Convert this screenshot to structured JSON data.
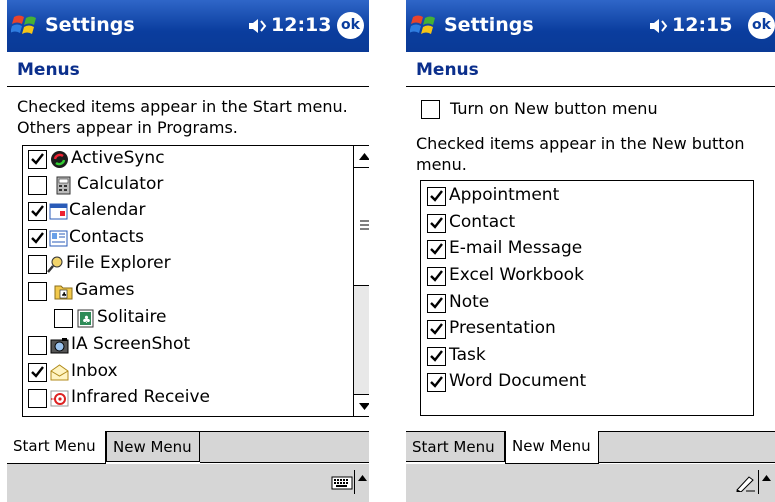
{
  "left": {
    "title": "Settings",
    "time": "12:13",
    "ok_label": "ok",
    "heading": "Menus",
    "description_line1": "Checked items appear in the Start menu.",
    "description_line2": "Others appear in Programs.",
    "items": [
      {
        "label": "ActiveSync",
        "checked": true,
        "icon": "activesync-icon"
      },
      {
        "label": "Calculator",
        "checked": false,
        "icon": "calculator-icon"
      },
      {
        "label": "Calendar",
        "checked": true,
        "icon": "calendar-icon"
      },
      {
        "label": "Contacts",
        "checked": true,
        "icon": "contacts-icon"
      },
      {
        "label": "File Explorer",
        "checked": false,
        "icon": "file-explorer-icon"
      },
      {
        "label": "Games",
        "checked": false,
        "icon": "games-folder-icon"
      },
      {
        "label": "Solitaire",
        "checked": false,
        "icon": "solitaire-icon"
      },
      {
        "label": "IA ScreenShot",
        "checked": false,
        "icon": "screenshot-icon"
      },
      {
        "label": "Inbox",
        "checked": true,
        "icon": "inbox-icon"
      },
      {
        "label": "Infrared Receive",
        "checked": false,
        "icon": "infrared-icon"
      }
    ],
    "tabs": [
      "Start Menu",
      "New Menu"
    ],
    "active_tab": "Start Menu"
  },
  "right": {
    "title": "Settings",
    "time": "12:15",
    "ok_label": "ok",
    "heading": "Menus",
    "toggle_label": "Turn on New button menu",
    "toggle_checked": false,
    "description_line1": "Checked items appear in the New button",
    "description_line2": "menu.",
    "items": [
      {
        "label": "Appointment",
        "checked": true
      },
      {
        "label": "Contact",
        "checked": true
      },
      {
        "label": "E-mail Message",
        "checked": true
      },
      {
        "label": "Excel Workbook",
        "checked": true
      },
      {
        "label": "Note",
        "checked": true
      },
      {
        "label": "Presentation",
        "checked": true
      },
      {
        "label": "Task",
        "checked": true
      },
      {
        "label": "Word Document",
        "checked": true
      }
    ],
    "tabs": [
      "Start Menu",
      "New Menu"
    ],
    "active_tab": "New Menu"
  },
  "colors": {
    "titlebar": "#0a3d9e",
    "heading": "#0b2f8c",
    "tab_inactive": "#d6d6d6"
  }
}
